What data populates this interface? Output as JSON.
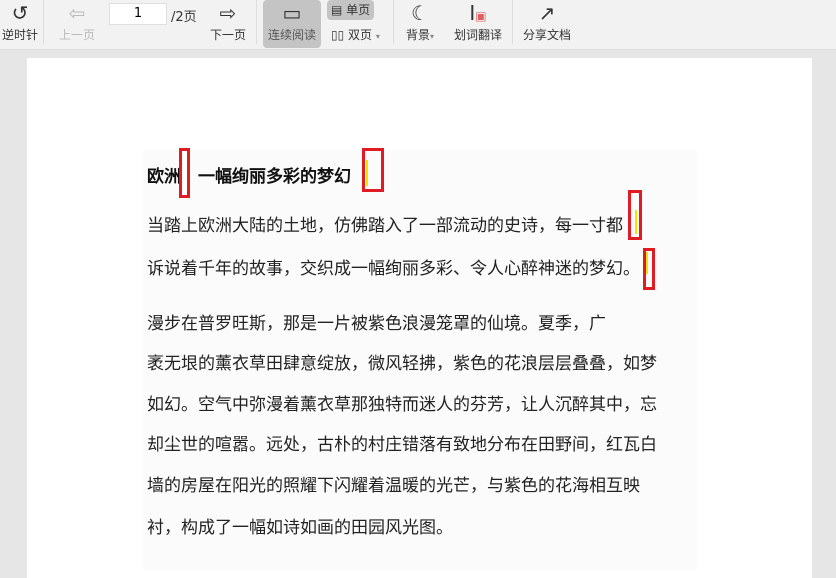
{
  "toolbar": {
    "rotate_ccw": "逆时针",
    "prev_page": "上一页",
    "page_current": "1",
    "page_total": "/2页",
    "next_page": "下一页",
    "continuous": "连续阅读",
    "single": "单页",
    "double": "双页",
    "background": "背景",
    "translate": "划词翻译",
    "share": "分享文档"
  },
  "document": {
    "title": "欧洲：一幅绚丽多彩的梦幻",
    "para1": [
      "当踏上欧洲大陆的土地，仿佛踏入了一部流动的史诗，每一寸都",
      "诉说着千年的故事，交织成一幅绚丽多彩、令人心醉神迷的梦幻。"
    ],
    "para2": [
      "漫步在普罗旺斯，那是一片被紫色浪漫笼罩的仙境。夏季，广",
      "袤无垠的薰衣草田肆意绽放，微风轻拂，紫色的花浪层层叠叠，如梦",
      "如幻。空气中弥漫着薰衣草那独特而迷人的芬芳，让人沉醉其中，忘",
      "却尘世的喧嚣。远处，古朴的村庄错落有致地分布在田野间，红瓦白",
      "墙的房屋在阳光的照耀下闪耀着温暖的光芒，与紫色的花海相互映",
      "衬，构成了一幅如诗如画的田园风光图。"
    ]
  }
}
